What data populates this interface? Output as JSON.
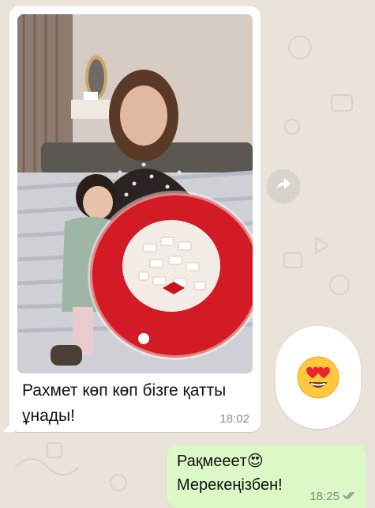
{
  "chat": {
    "incoming": {
      "text": "Рахмет көп көп бізге қатты ұнады!",
      "time": "18:02"
    },
    "sticker_emoji": "😍",
    "outgoing": {
      "line1": "Рақмеeeт😍",
      "line2": "Мерекеңізбен!",
      "time": "18:25"
    }
  },
  "icons": {
    "forward": "forward-arrow-icon",
    "read_receipt": "double-check-icon"
  },
  "colors": {
    "chat_background": "#e9e3da",
    "incoming_bubble": "#ffffff",
    "outgoing_bubble": "#dcf8c6",
    "timestamp": "#8c8c8c"
  }
}
